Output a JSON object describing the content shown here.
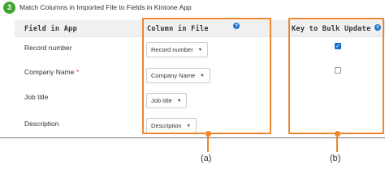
{
  "step": {
    "number": "3",
    "title": "Match Columns in Imported File to Fields in Kintone App"
  },
  "table": {
    "headers": {
      "field": "Field in App",
      "column": "Column in File",
      "key": "Key to Bulk Update"
    },
    "help_icon": "?",
    "required_marker": "*",
    "caret": "▼",
    "rows": [
      {
        "field": "Record number",
        "required": false,
        "column": "Record number",
        "key_checked": true
      },
      {
        "field": "Company Name",
        "required": true,
        "column": "Company Name",
        "key_checked": false
      },
      {
        "field": "Job title",
        "required": false,
        "column": "Job title",
        "key_checked": false
      },
      {
        "field": "Description",
        "required": false,
        "column": "Description",
        "key_checked": false
      }
    ]
  },
  "annotations": {
    "a_label": "(a)",
    "b_label": "(b)",
    "color": "#f0862a"
  },
  "colors": {
    "step_badge": "#3ea52e",
    "help_icon": "#1e73c8",
    "checkbox_checked": "#1a6fd1",
    "required": "#e0362c"
  }
}
